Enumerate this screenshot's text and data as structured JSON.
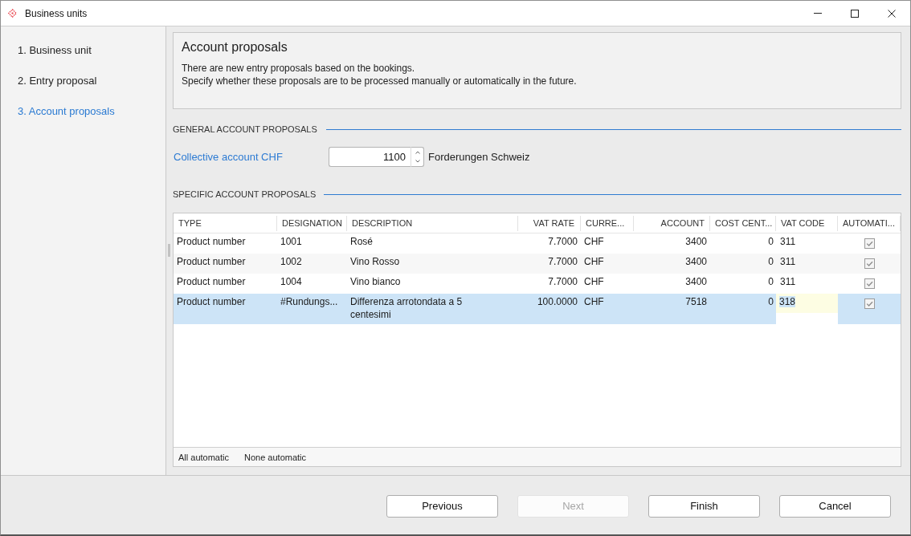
{
  "window": {
    "title": "Business units"
  },
  "steps": [
    {
      "label": "1. Business unit",
      "selected": false
    },
    {
      "label": "2. Entry proposal",
      "selected": false
    },
    {
      "label": "3. Account proposals",
      "selected": true
    }
  ],
  "header": {
    "title": "Account proposals",
    "description": [
      "There are new entry proposals based on the bookings.",
      "Specify whether these proposals are to be processed manually or automatically in the future."
    ]
  },
  "general_proposals": {
    "title": "GENERAL ACCOUNT PROPOSALS",
    "collective_account": {
      "label": "Collective account CHF",
      "value": "1100",
      "account_name": "Forderungen Schweiz"
    }
  },
  "specific_proposals": {
    "title": "SPECIFIC ACCOUNT PROPOSALS",
    "table": {
      "columns": [
        "TYPE",
        "DESIGNATION",
        "DESCRIPTION",
        "VAT RATE",
        "CURRE...",
        "ACCOUNT",
        "COST CENT...",
        "VAT CODE",
        "AUTOMATI..."
      ],
      "rows": [
        {
          "type": "Product number",
          "designation": "1001",
          "description": "Rosé",
          "vat_rate": "7.7000",
          "currency": "CHF",
          "account": "3400",
          "cost_center": "0",
          "vat_code": "311",
          "automatic": true,
          "selected": false,
          "vat_code_editing": false
        },
        {
          "type": "Product number",
          "designation": "1002",
          "description": "Vino Rosso",
          "vat_rate": "7.7000",
          "currency": "CHF",
          "account": "3400",
          "cost_center": "0",
          "vat_code": "311",
          "automatic": true,
          "selected": false,
          "vat_code_editing": false
        },
        {
          "type": "Product number",
          "designation": "1004",
          "description": "Vino bianco",
          "vat_rate": "7.7000",
          "currency": "CHF",
          "account": "3400",
          "cost_center": "0",
          "vat_code": "311",
          "automatic": true,
          "selected": false,
          "vat_code_editing": false
        },
        {
          "type": "Product number",
          "designation": "#Rundungs...",
          "description": "Differenza arrotondata a 5 centesimi",
          "vat_rate": "100.0000",
          "currency": "CHF",
          "account": "7518",
          "cost_center": "0",
          "vat_code": "318",
          "automatic": true,
          "selected": true,
          "vat_code_editing": true
        }
      ]
    },
    "actions": [
      "All automatic",
      "None automatic"
    ]
  },
  "buttons": [
    {
      "label": "Previous",
      "disabled": false
    },
    {
      "label": "Next",
      "disabled": true
    },
    {
      "label": "Finish",
      "disabled": false
    },
    {
      "label": "Cancel",
      "disabled": false
    }
  ]
}
